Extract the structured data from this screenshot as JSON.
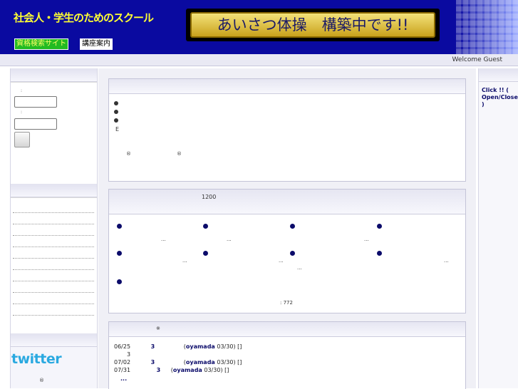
{
  "header": {
    "site_name": "社会人・学生のためのスクール",
    "nav": [
      "資格検索サイト",
      "講座案内"
    ],
    "banner_text": "あいさつ体操　構築中です!!"
  },
  "welcome": "Welcome Guest",
  "login": {
    "label1": ":",
    "label2": ":"
  },
  "twitter_logo": "twitter",
  "left_footer": "®",
  "panel1": {
    "bullet_texts": [
      "",
      "",
      ""
    ],
    "line_e": "E",
    "marks": [
      "®",
      "®"
    ]
  },
  "panel2": {
    "header_count": "1200",
    "ellipsis": "...",
    "footer": ": 772"
  },
  "panel3": {
    "header_icon": "※",
    "rows": [
      {
        "date": "06/25",
        "count": "3",
        "user": "oyamada",
        "stamp": "03/30",
        "tail": "[]"
      },
      {
        "date": "",
        "count": "3",
        "user": "",
        "stamp": "",
        "tail": ""
      },
      {
        "date": "07/02",
        "count": "3",
        "user": "oyamada",
        "stamp": "03/30",
        "tail": "[]"
      },
      {
        "date": "07/31",
        "count": "3",
        "user": "oyamada",
        "stamp": "03/30",
        "tail": "[]"
      }
    ],
    "more": "..."
  },
  "right": {
    "toggle": "Click !! ( Open/Close )"
  },
  "colors": {
    "header_bg": "#0a0aa0",
    "site_name": "#ffff33",
    "accent": "#0b0b6a",
    "twitter": "#2aa9e0"
  }
}
